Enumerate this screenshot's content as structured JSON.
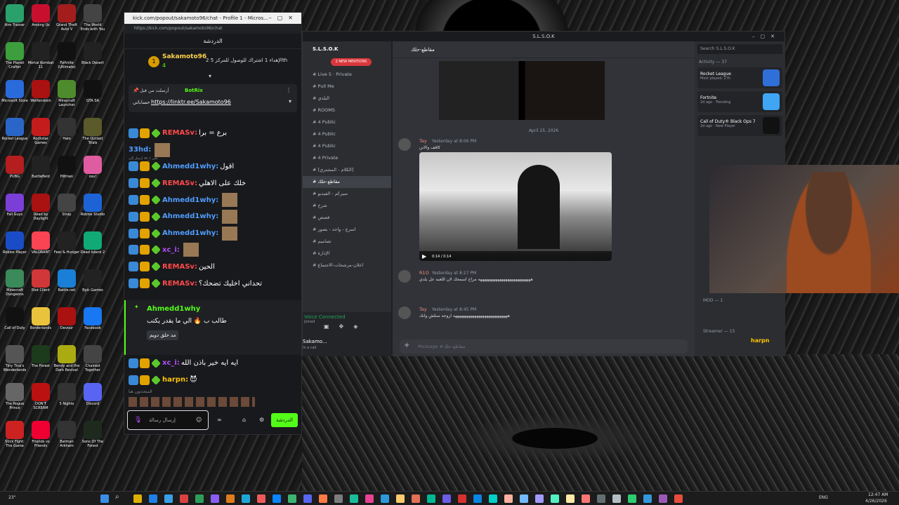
{
  "taskbar": {
    "weather": "23°",
    "lang": "ENG",
    "time": "12:47 AM",
    "date": "4/26/2026"
  },
  "desktop_icons": [
    {
      "label": "Aim Trainer",
      "color": "#2aa16b"
    },
    {
      "label": "Among Us",
      "color": "#c8102e"
    },
    {
      "label": "Grand Theft Auto V",
      "color": "#a31d1d"
    },
    {
      "label": "The World Ends with You",
      "color": "#444"
    },
    {
      "label": "The Planet Crafter",
      "color": "#3c9e3c"
    },
    {
      "label": "Mortal Kombat 11",
      "color": "#222"
    },
    {
      "label": "Fortnite (Ultimate)",
      "color": "#111"
    },
    {
      "label": "Black Desert",
      "color": "#222"
    },
    {
      "label": "Microsoft Store",
      "color": "#2a6bdb"
    },
    {
      "label": "Wolfenstein",
      "color": "#a11"
    },
    {
      "label": "Minecraft Launcher",
      "color": "#4e8b2c"
    },
    {
      "label": "GTA SA",
      "color": "#111"
    },
    {
      "label": "Rocket League",
      "color": "#2a66c7"
    },
    {
      "label": "Rockstar Games Launcher",
      "color": "#c41c1c"
    },
    {
      "label": "Halo",
      "color": "#333"
    },
    {
      "label": "The Outlast Trials",
      "color": "#5a5a2a"
    },
    {
      "label": "PUBG",
      "color": "#b41e1e"
    },
    {
      "label": "Battlefield",
      "color": "#222"
    },
    {
      "label": "Hitman",
      "color": "#111"
    },
    {
      "label": "osu!",
      "color": "#e05ca0"
    },
    {
      "label": "Fall Guys",
      "color": "#7b3fd8"
    },
    {
      "label": "Dead by Daylight",
      "color": "#a11"
    },
    {
      "label": "Stray",
      "color": "#444"
    },
    {
      "label": "Roblox Studio",
      "color": "#1d63d6"
    },
    {
      "label": "Roblox Player",
      "color": "#1a4cc7"
    },
    {
      "label": "VALORANT",
      "color": "#fa4454"
    },
    {
      "label": "Fear & Hunger",
      "color": "#222"
    },
    {
      "label": "Dead Island 2",
      "color": "#1a7"
    },
    {
      "label": "Minecraft Dungeons",
      "color": "#3a8a5a"
    },
    {
      "label": "Riot Client",
      "color": "#d13639"
    },
    {
      "label": "Battle.net",
      "color": "#1a7fd6"
    },
    {
      "label": "Epic Games",
      "color": "#222"
    },
    {
      "label": "Call of Duty",
      "color": "#111"
    },
    {
      "label": "Borderlands",
      "color": "#e9c33b"
    },
    {
      "label": "Devour",
      "color": "#a11"
    },
    {
      "label": "Facebook",
      "color": "#1877f2"
    },
    {
      "label": "Tiny Tina's Wonderlands",
      "color": "#555"
    },
    {
      "label": "The Forest",
      "color": "#1c3a1c"
    },
    {
      "label": "Bendy and the Dark Revival",
      "color": "#aa1"
    },
    {
      "label": "Chained Together",
      "color": "#444"
    },
    {
      "label": "The Rogue Prince",
      "color": "#666"
    },
    {
      "label": "DON'T SCREAM",
      "color": "#b11"
    },
    {
      "label": "5 Nights",
      "color": "#333"
    },
    {
      "label": "Discord",
      "color": "#5865f2"
    },
    {
      "label": "Stick Fight: The Game",
      "color": "#c22"
    },
    {
      "label": "Friends vs Friends",
      "color": "#e03"
    },
    {
      "label": "Batman Arkham",
      "color": "#333"
    },
    {
      "label": "Sons Of The Forest",
      "color": "#1e2a1e"
    }
  ],
  "kick": {
    "window_title": "kick.com/popout/sakamoto96/chat - Profile 1 - Micros...",
    "url": "https://kick.com/popout/sakamoto96/chat",
    "header": "الدردشة",
    "leader_name": "Sakamoto96",
    "leader_count": "4",
    "leader_rank": "1",
    "goal_text": "2 الإهداء 1 اشتراك للوصول للمركز 5th",
    "pinned_by": "أرسلت من قبل",
    "pinned_user": "BotRix",
    "pinned_text": "حساباتي",
    "pinned_link": "https://linktr.ee/Sakamoto96",
    "messages": [
      {
        "user": "REMASv",
        "color": "r",
        "text": "برع = برا",
        "emote": false
      },
      {
        "user": "33hd",
        "color": "bl",
        "text": "",
        "emote": true,
        "nobadge": true
      },
      {
        "user": "Ahmedd1why",
        "color": "bl",
        "text": "اقول",
        "emote": false,
        "reply": "ارسل إلى xc_i على"
      },
      {
        "user": "REMASv",
        "color": "r",
        "text": "خلك على الاهلي",
        "emote": false
      },
      {
        "user": "Ahmedd1why",
        "color": "bl",
        "text": "",
        "emote": true
      },
      {
        "user": "Ahmedd1why",
        "color": "bl",
        "text": "",
        "emote": true
      },
      {
        "user": "Ahmedd1why",
        "color": "bl",
        "text": "",
        "emote": true
      },
      {
        "user": "xc_i",
        "color": "p",
        "text": "",
        "emote": true
      },
      {
        "user": "REMASv",
        "color": "r",
        "text": "الحين",
        "emote": false
      },
      {
        "user": "REMASv",
        "color": "r",
        "text": "تحداني اخليك تضحك؟",
        "emote": false
      }
    ],
    "highlight_user": "Ahmedd1why",
    "highlight_text": "طالب ب 🔥 الي ما يقدر يكتب",
    "highlight_reply": "مد حلق دويم",
    "after": [
      {
        "user": "xc_i",
        "color": "p",
        "text": "ايه ايه خير باذن الله"
      },
      {
        "user": "harpn",
        "color": "y",
        "text": "😈"
      }
    ],
    "chatters_label": "المتحدثون هنا",
    "input_placeholder": "إرسال رسالة",
    "send_label": "الدردشة"
  },
  "discord": {
    "window_title": "S.L.S.O.K",
    "server": "S.L.S.O.K",
    "new_mentions": "2 NEW MENTIONS",
    "channels": [
      {
        "name": "Live 5 · Private",
        "on": false
      },
      {
        "name": "Pull Me",
        "on": false
      },
      {
        "name": "البلدي",
        "on": false
      },
      {
        "name": "ROOMS",
        "on": false
      },
      {
        "name": "4 Public",
        "on": false
      },
      {
        "name": "4 Public",
        "on": false
      },
      {
        "name": "4 Public",
        "on": false
      },
      {
        "name": "4 Private",
        "on": false
      },
      {
        "name": "[الكلام - المشتري]",
        "on": false
      },
      {
        "name": "مقاطع-حلك",
        "on": true
      },
      {
        "name": "سيركم - الفيديو",
        "on": false
      },
      {
        "name": "شرح",
        "on": false
      },
      {
        "name": "قصص",
        "on": false
      },
      {
        "name": "اسرع - واحد - بصور",
        "on": false
      },
      {
        "name": "تصاميم",
        "on": false
      },
      {
        "name": "الإدارة",
        "on": false
      },
      {
        "name": "اعلان-مرشحات-الاجتماع",
        "on": false
      }
    ],
    "channel_title": "مقاطع-حلك",
    "date_divider": "April 25, 2026",
    "msgs": [
      {
        "user": "Tay",
        "time": "Yesterday at 8:06 PM",
        "text": "كافف والانن"
      },
      {
        "user": "R1O",
        "time": "Yesterday at 8:27 PM",
        "text": "هههههههههههههههههههههههههههه مراح اسمحك لان اللعبه عل بلدي"
      },
      {
        "user": "Tay",
        "time": "Yesterday at 8:45 PM",
        "text": "ههههههههههههههههههههههههههههه اروحه ستلش وانك"
      }
    ],
    "video_time": "0:14 / 0:14",
    "voice": "Voice Connected",
    "voice_sub": "Joined",
    "user": "Sakamo...",
    "user_status": "In a call",
    "message_placeholder": "Message #مقاطع-حلك",
    "search": "Search S.L.S.O.K",
    "activity": "Activity — 37",
    "games": [
      {
        "name": "Rocket League",
        "sub": "Most played: 27h",
        "color": "#2f6fd8"
      },
      {
        "name": "Fortnite",
        "sub": "2d ago · Trending",
        "color": "#3ea6f2"
      },
      {
        "name": "Call of Duty® Black Ops 7",
        "sub": "2d ago · New Player",
        "color": "#111"
      }
    ],
    "mod_label": "MOD — 1",
    "streamer_label": "Streamer — 15",
    "streamer_name": "harpn"
  }
}
